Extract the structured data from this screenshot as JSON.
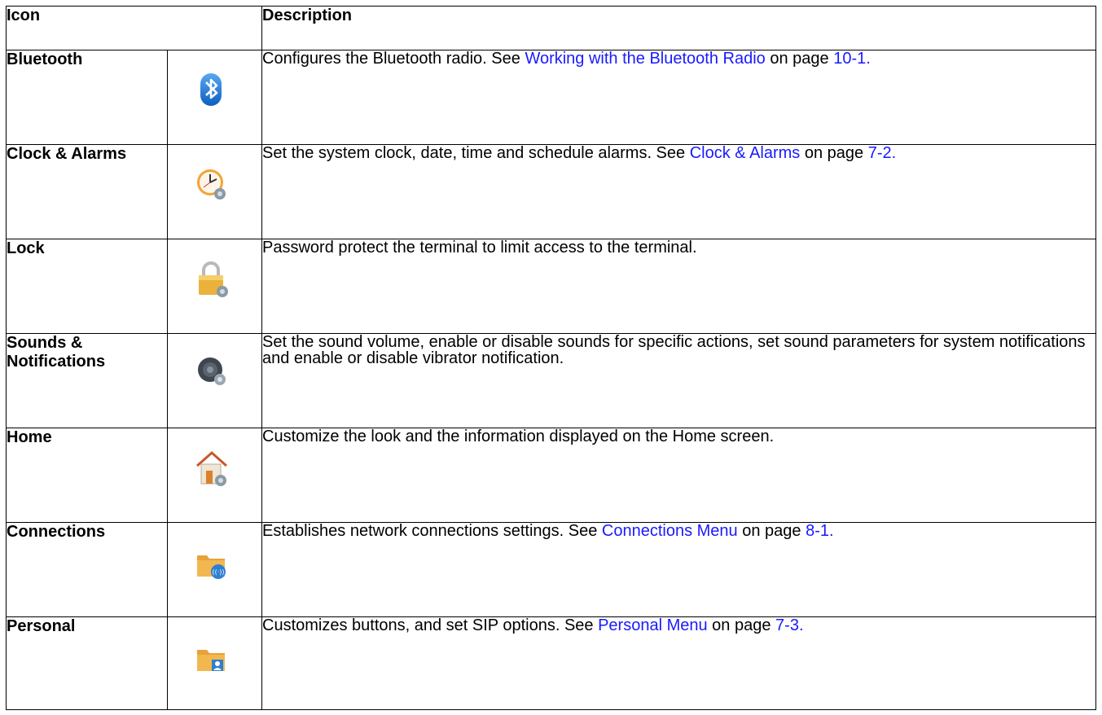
{
  "table": {
    "headers": {
      "icon": "Icon",
      "description": "Description"
    },
    "rows": [
      {
        "name": "Bluetooth",
        "icon": "bluetooth-icon",
        "desc_pre": "Configures the Bluetooth radio. See ",
        "link_text": "Working with the Bluetooth Radio",
        "desc_mid": " on page ",
        "page_ref": "10-1."
      },
      {
        "name": "Clock & Alarms",
        "icon": "clock-alarms-icon",
        "desc_pre": "Set the system clock, date, time and schedule alarms. See ",
        "link_text": "Clock & Alarms",
        "desc_mid": " on page ",
        "page_ref": "7-2."
      },
      {
        "name": "Lock",
        "icon": "lock-icon",
        "desc": "Password protect the terminal to limit access to the terminal."
      },
      {
        "name": "Sounds & Notifications",
        "icon": "sounds-notifications-icon",
        "desc": "Set the sound volume, enable or disable sounds for specific actions, set sound parameters for system notifications and enable or disable vibrator notification."
      },
      {
        "name": "Home",
        "icon": "home-settings-icon",
        "desc": "Customize the look and the information displayed on the Home screen."
      },
      {
        "name": "Connections",
        "icon": "connections-folder-icon",
        "desc_pre": "Establishes network connections settings. See ",
        "link_text": "Connections Menu",
        "desc_mid": " on page ",
        "page_ref": "8-1."
      },
      {
        "name": "Personal",
        "icon": "personal-folder-icon",
        "desc_pre": "Customizes buttons, and set SIP options. See ",
        "link_text": "Personal Menu",
        "desc_mid": " on page ",
        "page_ref": "7-3."
      }
    ]
  },
  "colors": {
    "link": "#1a1aff",
    "border": "#000000"
  }
}
